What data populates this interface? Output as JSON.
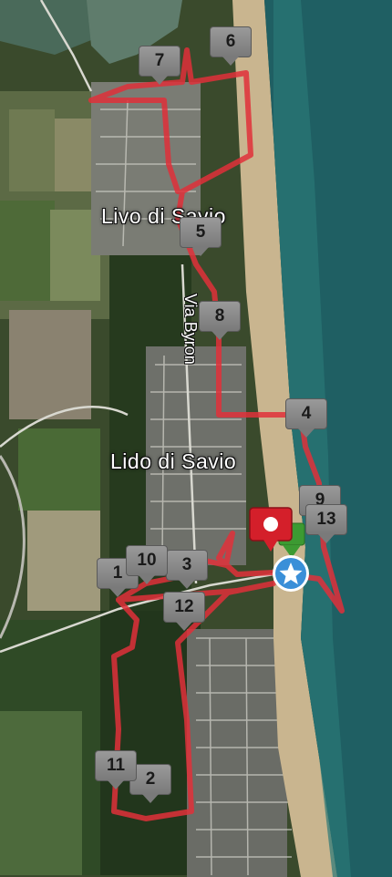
{
  "map": {
    "labels": {
      "town_north": "Livo di Savio",
      "town_south": "Lido di Savio",
      "road": "Via Byron"
    },
    "route_color": "#e0303a",
    "sea_color": "#1f5f63",
    "beach_color": "#c9b58f",
    "markers": [
      {
        "id": "1",
        "label": "1"
      },
      {
        "id": "2",
        "label": "2"
      },
      {
        "id": "3",
        "label": "3"
      },
      {
        "id": "4",
        "label": "4"
      },
      {
        "id": "5",
        "label": "5"
      },
      {
        "id": "6",
        "label": "6"
      },
      {
        "id": "7",
        "label": "7"
      },
      {
        "id": "8",
        "label": "8"
      },
      {
        "id": "9",
        "label": "9"
      },
      {
        "id": "10",
        "label": "10"
      },
      {
        "id": "11",
        "label": "11"
      },
      {
        "id": "12",
        "label": "12"
      },
      {
        "id": "13",
        "label": "13"
      }
    ],
    "start_marker_icon": "star-icon",
    "end_marker_icon": "finish-dot-icon",
    "lap_marker_icon": "green-arrow-icon"
  }
}
